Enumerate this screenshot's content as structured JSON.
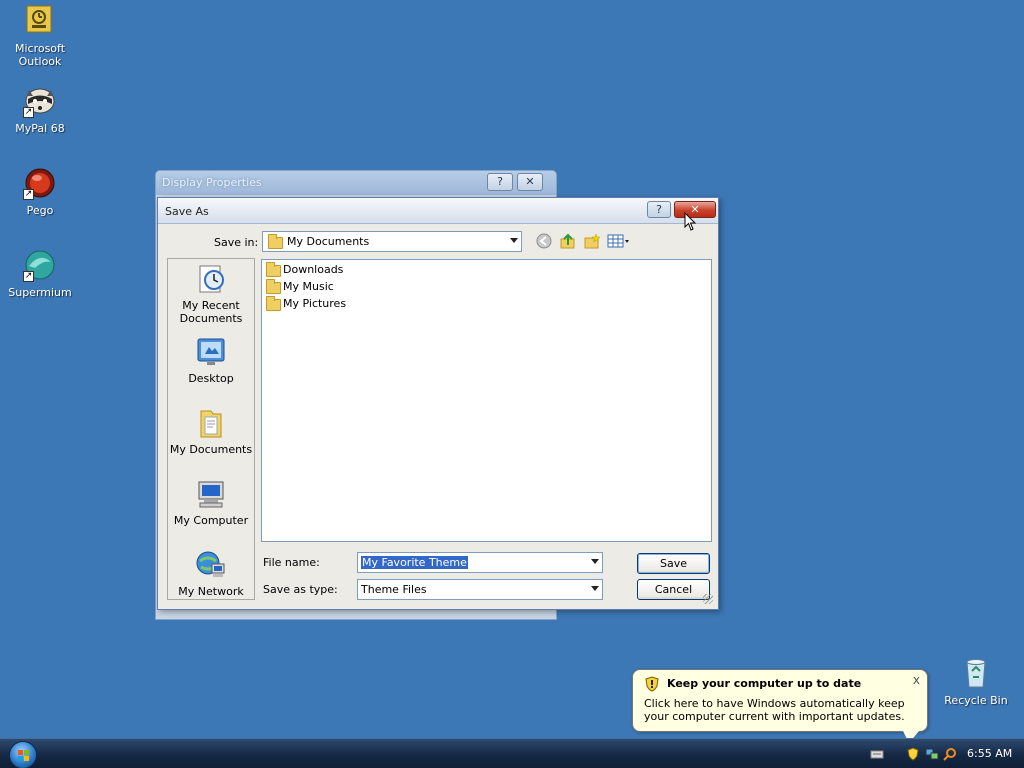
{
  "desktop": {
    "icons": [
      {
        "label_line1": "Microsoft",
        "label_line2": "Outlook",
        "icon": "outlook-icon"
      },
      {
        "label": "MyPal 68",
        "icon": "raccoon-icon"
      },
      {
        "label": "Pego",
        "icon": "pego-icon"
      },
      {
        "label": "Supermium",
        "icon": "supermium-icon"
      }
    ],
    "recycle_bin": {
      "label": "Recycle Bin",
      "icon": "recycle-bin-icon"
    }
  },
  "back_window": {
    "title": "Display Properties",
    "help_glyph": "?",
    "close_glyph": "✕"
  },
  "dialog": {
    "title": "Save As",
    "help_glyph": "?",
    "close_glyph": "✕",
    "save_in_label": "Save in:",
    "save_in_value": "My Documents",
    "places": [
      {
        "label": "My Recent Documents",
        "icon": "recent-documents-icon"
      },
      {
        "label": "Desktop",
        "icon": "desktop-icon"
      },
      {
        "label": "My Documents",
        "icon": "my-documents-icon"
      },
      {
        "label": "My Computer",
        "icon": "my-computer-icon"
      },
      {
        "label": "My Network",
        "icon": "my-network-icon"
      }
    ],
    "files": [
      "Downloads",
      "My Music",
      "My Pictures"
    ],
    "file_name_label": "File name:",
    "file_name_value": "My Favorite Theme",
    "save_as_type_label": "Save as type:",
    "save_as_type_value": "Theme Files",
    "save_button": "Save",
    "cancel_button": "Cancel"
  },
  "balloon": {
    "title": "Keep your computer up to date",
    "text": "Click here to have Windows automatically keep your computer current with important updates.",
    "close_glyph": "x"
  },
  "taskbar": {
    "clock": "6:55 AM"
  },
  "colors": {
    "desktop": "#3d78b6",
    "taskbar": "#152844",
    "selection": "#3367c8",
    "balloon": "#ffffe1"
  }
}
